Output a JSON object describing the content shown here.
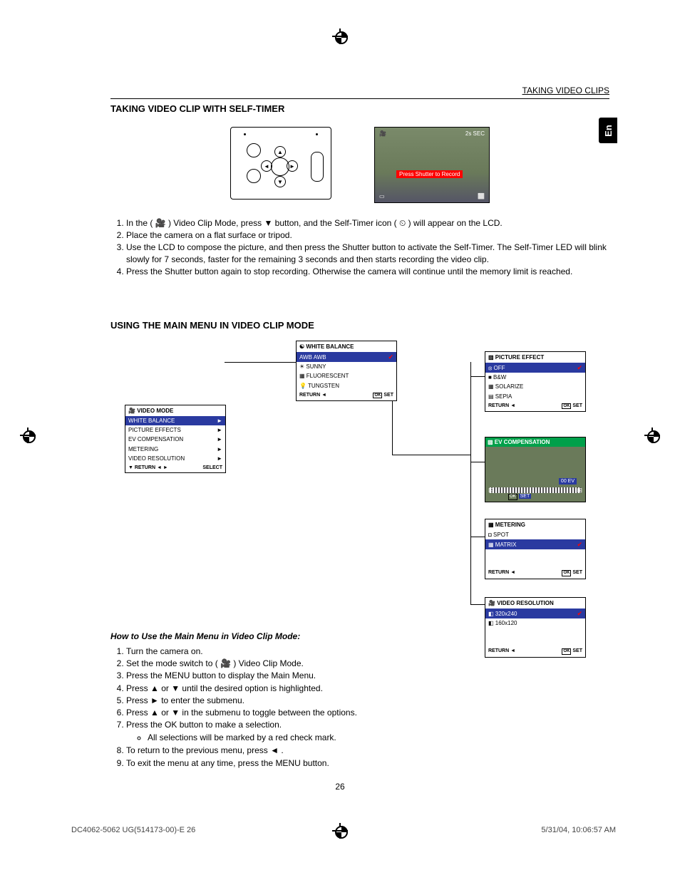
{
  "header": {
    "section_label": "TAKING VIDEO CLIPS"
  },
  "lang_tab": "En",
  "title1": "TAKING VIDEO CLIP WITH SELF-TIMER",
  "lcd": {
    "time": "2s SEC",
    "banner": "Press Shutter to Record"
  },
  "steps1": [
    "In the ( 🎥 ) Video Clip Mode, press ▼ button, and the Self-Timer icon ( ⏲ ) will appear on the LCD.",
    "Place the camera on a flat surface or tripod.",
    "Use the LCD to compose the picture, and then press the Shutter button to activate the Self-Timer. The Self-Timer LED will blink slowly for 7 seconds, faster for the remaining 3 seconds and then starts recording the video clip.",
    "Press the Shutter button again to stop recording. Otherwise the camera will continue until the memory limit is reached."
  ],
  "title2": "USING THE MAIN MENU IN VIDEO CLIP MODE",
  "video_mode_menu": {
    "title": "VIDEO MODE",
    "items": [
      "WHITE BALANCE",
      "PICTURE EFFECTS",
      "EV COMPENSATION",
      "METERING",
      "VIDEO RESOLUTION"
    ],
    "footer": {
      "left": "RETURN ◄ ►",
      "right": "SELECT"
    }
  },
  "wb_menu": {
    "title": "WHITE BALANCE",
    "items": [
      "AWB AWB",
      "☀ SUNNY",
      "▦ FLUORESCENT",
      "💡 TUNGSTEN"
    ],
    "footer": {
      "left": "RETURN ◄",
      "right": "SET"
    }
  },
  "pe_menu": {
    "title": "PICTURE EFFECT",
    "items": [
      "⦻ OFF",
      "■ B&W",
      "▦ SOLARIZE",
      "▤ SEPIA"
    ],
    "footer": {
      "left": "RETURN ◄",
      "right": "SET"
    }
  },
  "ev_menu": {
    "title": "EV COMPENSATION",
    "value": "00  EV",
    "foot_ok": "OK",
    "foot_set": "SET"
  },
  "met_menu": {
    "title": "METERING",
    "items": [
      "◘ SPOT",
      "▦ MATRIX"
    ],
    "footer": {
      "left": "RETURN ◄",
      "right": "SET"
    }
  },
  "res_menu": {
    "title": "VIDEO RESOLUTION",
    "items": [
      "◧ 320x240",
      "◧ 160x120"
    ],
    "footer": {
      "left": "RETURN ◄",
      "right": "SET"
    }
  },
  "howto_title": "How to Use the Main Menu in Video Clip Mode:",
  "steps2": [
    "Turn the camera on.",
    "Set the mode switch to ( 🎥 ) Video Clip Mode.",
    "Press the MENU button to display the Main Menu.",
    "Press ▲ or ▼ until the desired option is highlighted.",
    "Press ► to enter the submenu.",
    "Press ▲ or ▼ in the submenu to toggle between the options.",
    "Press the OK button to make a selection.",
    "To return to the previous menu, press ◄ .",
    "To exit the menu at any time, press the MENU button."
  ],
  "bullet": "All selections will be marked by a red check mark.",
  "page_number": "26",
  "footer": {
    "left": "DC4062-5062 UG(514173-00)-E   26",
    "right": "5/31/04, 10:06:57 AM"
  },
  "ok_label": "OK"
}
